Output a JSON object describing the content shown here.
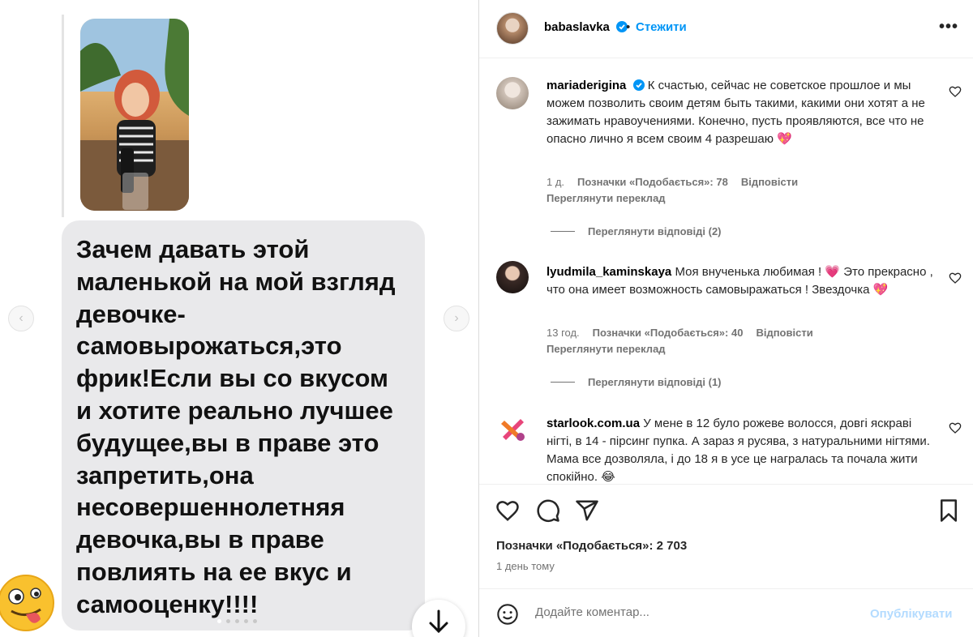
{
  "post": {
    "bubble_text": "Зачем  давать этой\nмаленькой на мой взгляд\nдевочке-\nсамовырожаться,это\nфрик!Если вы со вкусом\nи хотите реально лучшее\nбудущее,вы в праве это\nзапретить,она\nнесовершеннолетняя\nдевочка,вы в праве\nповлиять на ее вкус и\nсамооценку!!!!",
    "carousel_dots": 5,
    "carousel_active_dot": 0
  },
  "header": {
    "username": "babaslavka",
    "separator": "•",
    "follow_label": "Стежити",
    "more_label": "•••"
  },
  "comments": [
    {
      "username": "mariaderigina",
      "verified": true,
      "text": "К счастью, сейчас не советское прошлое и мы можем позволить своим детям быть такими, какими они хотят а не зажимать нравоучениями. Конечно, пусть проявляются, все что не опасно лично я всем своим 4 разрешаю 💖",
      "time": "1 д.",
      "likes": "Позначки «Подобається»: 78",
      "reply": "Відповісти",
      "translate": "Переглянути переклад",
      "view_replies": "Переглянути відповіді (2)"
    },
    {
      "username": "lyudmila_kaminskaya",
      "verified": false,
      "text": "Моя внученька любимая ! 💗 Это прекрасно , что она имеет возможность самовыражаться ! Звездочка 💖",
      "time": "13 год.",
      "likes": "Позначки «Подобається»: 40",
      "reply": "Відповісти",
      "translate": "Переглянути переклад",
      "view_replies": "Переглянути відповіді (1)"
    },
    {
      "username": "starlook.com.ua",
      "verified": false,
      "text": "У мене в 12 було рожеве волосся, довгі яскраві нігті, в 14 - пірсинг пупка. А зараз я русява, з натуральними нігтями. Мама все дозволяла, і до 18 я в усе це награлась та почала жити спокійно. 😂"
    }
  ],
  "footer": {
    "likes": "Позначки «Подобається»: 2 703",
    "time": "1 день тому",
    "comment_placeholder": "Додайте коментар...",
    "publish_label": "Опублікувати"
  },
  "colors": {
    "accent": "#0095f6",
    "publish_disabled": "#b3dbff",
    "bubble": "#e9e9eb",
    "meta_text": "#737373"
  },
  "icons": [
    "chevron-left-icon",
    "chevron-right-icon",
    "down-arrow-icon",
    "tongue-out-emoji-icon",
    "verified-badge-icon",
    "heart-icon",
    "comment-icon",
    "share-icon",
    "bookmark-icon",
    "smile-icon",
    "more-icon"
  ]
}
